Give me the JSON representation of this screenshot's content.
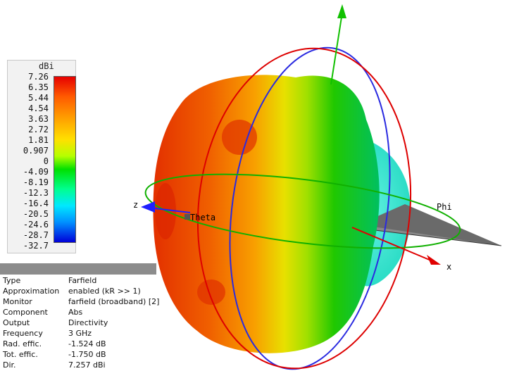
{
  "legend": {
    "unit": "dBi",
    "ticks": [
      "7.26",
      "6.35",
      "5.44",
      "4.54",
      "3.63",
      "2.72",
      "1.81",
      "0.907",
      "0",
      "-4.09",
      "-8.19",
      "-12.3",
      "-16.4",
      "-20.5",
      "-24.6",
      "-28.7",
      "-32.7"
    ]
  },
  "axes": {
    "z": "z",
    "x": "x",
    "theta": "Theta",
    "phi": "Phi"
  },
  "info": {
    "rows": [
      {
        "k": "Type",
        "v": "Farfield"
      },
      {
        "k": "Approximation",
        "v": "enabled (kR >> 1)"
      },
      {
        "k": "Monitor",
        "v": "farfield (broadband) [2]"
      },
      {
        "k": "Component",
        "v": "Abs"
      },
      {
        "k": "Output",
        "v": "Directivity"
      },
      {
        "k": "Frequency",
        "v": "3 GHz"
      },
      {
        "k": "Rad. effic.",
        "v": "-1.524 dB"
      },
      {
        "k": "Tot. effic.",
        "v": "-1.750 dB"
      },
      {
        "k": "Dir.",
        "v": "7.257 dBi"
      }
    ]
  },
  "colors": {
    "x_axis": "#e00000",
    "y_axis": "#00b000",
    "z_axis": "#2020ff"
  }
}
